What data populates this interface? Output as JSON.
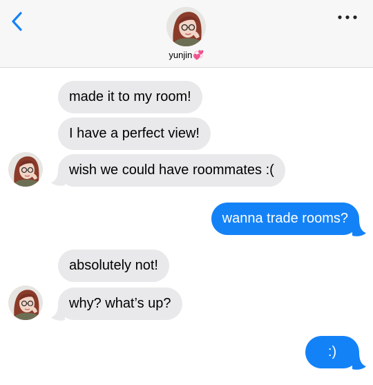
{
  "header": {
    "contact_name": "yunjin",
    "name_emoji": "💞",
    "back_icon": "chevron-left-icon",
    "more_icon": "ellipsis-icon",
    "accent": "#1482f7"
  },
  "messages": [
    {
      "side": "in",
      "text": "made it to my room!"
    },
    {
      "side": "in",
      "text": "I have a perfect view!"
    },
    {
      "side": "in",
      "text": "wish we could have roommates :("
    },
    {
      "side": "out",
      "text": "wanna trade rooms?"
    },
    {
      "side": "in",
      "text": "absolutely not!"
    },
    {
      "side": "in",
      "text": "why? what’s up?"
    },
    {
      "side": "out",
      "text": ":)"
    }
  ],
  "colors": {
    "incoming_bubble": "#e9e9eb",
    "outgoing_bubble": "#1482f7",
    "header_bg": "#f7f7f7"
  }
}
